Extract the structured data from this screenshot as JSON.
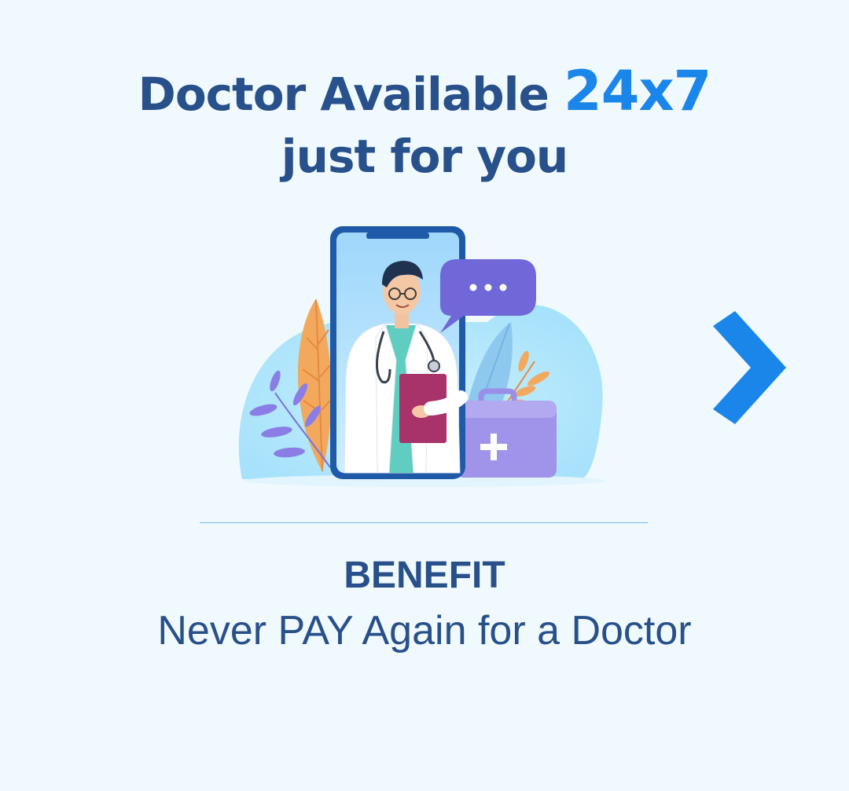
{
  "headline": {
    "line1_text": "Doctor Available",
    "line1_accent": "24x7",
    "line2": "just for you"
  },
  "illustration": {
    "icon": "doctor-on-phone-illustration",
    "chat_bubble_text": "..."
  },
  "navigation": {
    "next_icon": "chevron-right-icon"
  },
  "benefit": {
    "title": "BENEFIT",
    "description": "Never PAY Again for a Doctor"
  },
  "colors": {
    "background": "#f0f9fd",
    "heading": "#28508a",
    "accent": "#1a86ea",
    "divider": "#78b6ec"
  }
}
